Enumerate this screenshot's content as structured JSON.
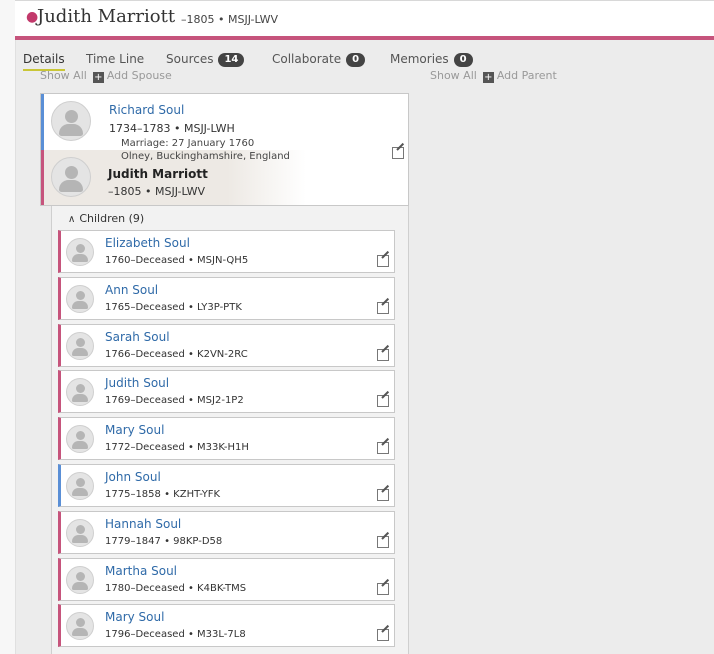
{
  "header": {
    "name": "Judith Marriott",
    "meta": "–1805 • MSJJ-LWV"
  },
  "tabs": [
    {
      "label": "Details"
    },
    {
      "label": "Time Line"
    },
    {
      "label": "Sources",
      "count": "14"
    },
    {
      "label": "Collaborate",
      "count": "0"
    },
    {
      "label": "Memories",
      "count": "0"
    }
  ],
  "spouses_controls": {
    "show_all": "Show All",
    "add": "Add Spouse"
  },
  "parents_controls": {
    "show_all": "Show All",
    "add": "Add Parent"
  },
  "couple": {
    "husband": {
      "name": "Richard Soul",
      "dates": "1734–1783 •  MSJJ-LWH"
    },
    "marriage_date": "Marriage: 27 January 1760",
    "marriage_place": "Olney, Buckinghamshire, England",
    "wife": {
      "name": "Judith Marriott",
      "dates": "–1805 •  MSJJ-LWV"
    }
  },
  "children": {
    "label": "Children (9)",
    "items": [
      {
        "name": "Elizabeth Soul",
        "dates": "1760–Deceased •  MSJN-QH5",
        "sex": "female"
      },
      {
        "name": "Ann Soul",
        "dates": "1765–Deceased •  LY3P-PTK",
        "sex": "female"
      },
      {
        "name": "Sarah Soul",
        "dates": "1766–Deceased •  K2VN-2RC",
        "sex": "female"
      },
      {
        "name": "Judith Soul",
        "dates": "1769–Deceased •  MSJ2-1P2",
        "sex": "female"
      },
      {
        "name": "Mary Soul",
        "dates": "1772–Deceased •  M33K-H1H",
        "sex": "female"
      },
      {
        "name": "John Soul",
        "dates": "1775–1858 •  KZHT-YFK",
        "sex": "male"
      },
      {
        "name": "Hannah Soul",
        "dates": "1779–1847 •  98KP-D58",
        "sex": "female"
      },
      {
        "name": "Martha Soul",
        "dates": "1780–Deceased •  K4BK-TMS",
        "sex": "female"
      },
      {
        "name": "Mary Soul",
        "dates": "1796–Deceased •  M33L-7L8",
        "sex": "female"
      }
    ]
  },
  "colors": {
    "female": "#c6547c",
    "male": "#5a8fd6",
    "link": "#2f6aa8",
    "tab_underline": "#c9c637"
  }
}
